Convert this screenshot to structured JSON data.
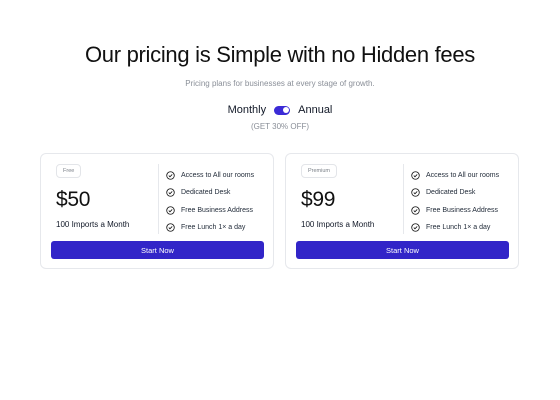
{
  "header": {
    "title": "Our pricing is Simple with no Hidden fees",
    "subtitle": "Pricing plans for businesses at every stage of growth."
  },
  "billing_toggle": {
    "monthly_label": "Monthly",
    "annual_label": "Annual",
    "selected": "Annual",
    "discount_note": "(GET 30% OFF)"
  },
  "plans": [
    {
      "badge": "Free",
      "price": "$50",
      "imports": "100 Imports a Month",
      "features": [
        "Access to All our rooms",
        "Dedicated Desk",
        "Free Business Address",
        "Free Lunch 1× a day"
      ],
      "cta": "Start Now"
    },
    {
      "badge": "Premium",
      "price": "$99",
      "imports": "100 Imports a Month",
      "features": [
        "Access to All our rooms",
        "Dedicated Desk",
        "Free Business Address",
        "Free Lunch 1× a day"
      ],
      "cta": "Start Now"
    }
  ],
  "colors": {
    "accent": "#3225c8",
    "toggle": "#3b2bd6",
    "muted_text": "#8a8f98",
    "border": "#e6e8ec"
  },
  "icons": {
    "feature": "check-circle-icon"
  }
}
